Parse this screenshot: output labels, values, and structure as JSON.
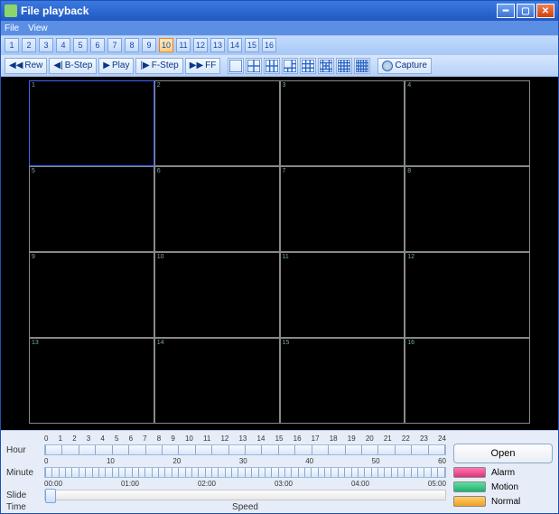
{
  "window": {
    "title": "File playback"
  },
  "menu": {
    "file": "File",
    "view": "View"
  },
  "channels": [
    "1",
    "2",
    "3",
    "4",
    "5",
    "6",
    "7",
    "8",
    "9",
    "10",
    "11",
    "12",
    "13",
    "14",
    "15",
    "16"
  ],
  "channel_selected": 10,
  "playback": {
    "rew": "Rew",
    "bstep": "B-Step",
    "play": "Play",
    "fstep": "F-Step",
    "ff": "FF",
    "capture": "Capture"
  },
  "grid_labels": [
    "1",
    "2",
    "3",
    "4",
    "5",
    "6",
    "7",
    "8",
    "9",
    "10",
    "11",
    "12",
    "13",
    "14",
    "15",
    "16"
  ],
  "timeline": {
    "hour_label": "Hour",
    "minute_label": "Minute",
    "slide_label": "Slide",
    "time_label": "Time",
    "speed_label": "Speed",
    "hours": [
      "0",
      "1",
      "2",
      "3",
      "4",
      "5",
      "6",
      "7",
      "8",
      "9",
      "10",
      "11",
      "12",
      "13",
      "14",
      "15",
      "16",
      "17",
      "18",
      "19",
      "20",
      "21",
      "22",
      "23",
      "24"
    ],
    "minutes": [
      "0",
      "10",
      "20",
      "30",
      "40",
      "50",
      "60"
    ],
    "timestamps": [
      "00:00",
      "01:00",
      "02:00",
      "03:00",
      "04:00",
      "05:00"
    ]
  },
  "controls": {
    "open": "Open"
  },
  "legend": {
    "alarm": "Alarm",
    "motion": "Motion",
    "normal": "Normal"
  }
}
